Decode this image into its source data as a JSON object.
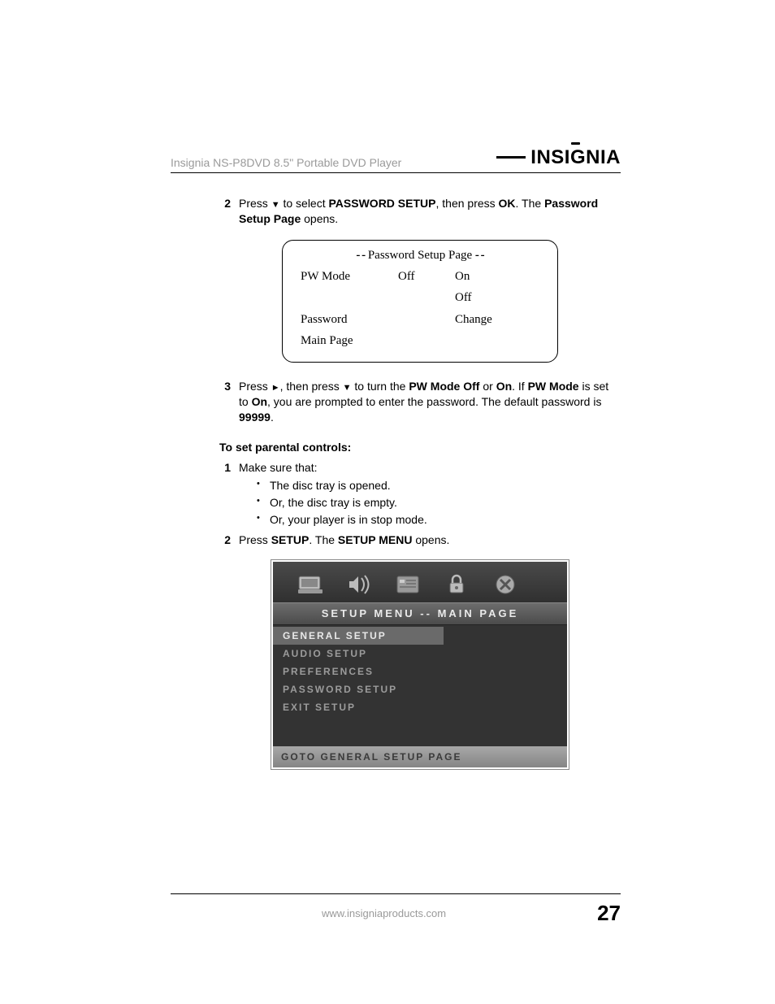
{
  "header": {
    "product": "Insignia NS-P8DVD 8.5\" Portable DVD Player",
    "brand_a": "INSI",
    "brand_g": "G",
    "brand_b": "NIA"
  },
  "step2": {
    "num": "2",
    "t1": "Press ",
    "glyph": "▼",
    "t2": " to select ",
    "bold1": "PASSWORD SETUP",
    "t3": ", then press ",
    "bold2": "OK",
    "t4": ". The ",
    "bold3": "Password Setup Page",
    "t5": " opens."
  },
  "pwbox": {
    "dash": "- -",
    "title": "Password Setup Page",
    "r1": {
      "c1": "PW  Mode",
      "c2": "Off",
      "c3": "On"
    },
    "r2": {
      "c1": "",
      "c2": "",
      "c3": "Off"
    },
    "r3": {
      "c1": "Password",
      "c2": "",
      "c3": "Change"
    },
    "r4": {
      "c1": "Main Page",
      "c2": "",
      "c3": ""
    }
  },
  "step3": {
    "num": "3",
    "t1": "Press ",
    "glyph1": "►",
    "t2": ", then press ",
    "glyph2": "▼",
    "t3": " to turn the ",
    "bold1": "PW Mode Off",
    "t4": " or ",
    "bold2": "On",
    "t5": ". If ",
    "bold3": "PW Mode",
    "t6": " is set to ",
    "bold4": "On",
    "t7": ", you are prompted to enter the password. The default password is ",
    "bold5": "99999",
    "t8": "."
  },
  "sectionHead": "To set parental controls:",
  "stepA": {
    "num": "1",
    "text": "Make sure that:"
  },
  "bullets": [
    "The disc tray is opened.",
    "Or, the disc tray is empty.",
    "Or, your player is in stop mode."
  ],
  "stepB": {
    "num": "2",
    "t1": "Press ",
    "bold1": "SETUP",
    "t2": ". The ",
    "bold2": "SETUP MENU",
    "t3": " opens."
  },
  "setup": {
    "banner": "SETUP  MENU  --  MAIN  PAGE",
    "items": [
      "GENERAL  SETUP",
      "AUDIO  SETUP",
      "PREFERENCES",
      "PASSWORD  SETUP",
      "EXIT  SETUP"
    ],
    "footer": "GOTO  GENERAL  SETUP  PAGE"
  },
  "footer": {
    "url": "www.insigniaproducts.com",
    "page": "27"
  }
}
